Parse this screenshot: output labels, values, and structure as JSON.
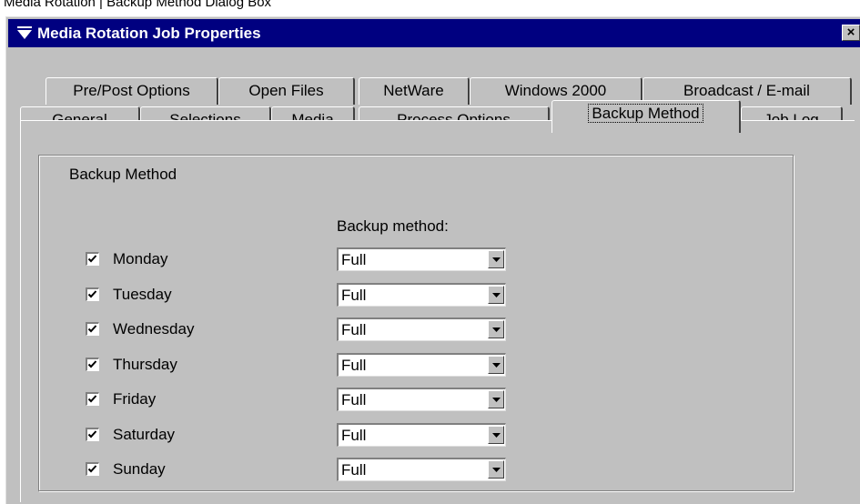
{
  "caption": "Media Rotation | Backup Method Dialog Box",
  "window": {
    "title": "Media Rotation Job Properties",
    "close_glyph": "×"
  },
  "tabs_top": [
    {
      "label": "Pre/Post Options"
    },
    {
      "label": "Open Files"
    },
    {
      "label": "NetWare"
    },
    {
      "label": "Windows 2000"
    },
    {
      "label": "Broadcast / E-mail"
    }
  ],
  "tabs_bottom": [
    {
      "label": "General"
    },
    {
      "label": "Selections"
    },
    {
      "label": "Media"
    },
    {
      "label": "Process Options"
    },
    {
      "label": "Backup Method",
      "active": true
    },
    {
      "label": "Job Log"
    }
  ],
  "group": {
    "label": "Backup Method",
    "column_header": "Backup method:",
    "rows": [
      {
        "day": "Monday",
        "checked": true,
        "method": "Full"
      },
      {
        "day": "Tuesday",
        "checked": true,
        "method": "Full"
      },
      {
        "day": "Wednesday",
        "checked": true,
        "method": "Full"
      },
      {
        "day": "Thursday",
        "checked": true,
        "method": "Full"
      },
      {
        "day": "Friday",
        "checked": true,
        "method": "Full"
      },
      {
        "day": "Saturday",
        "checked": true,
        "method": "Full"
      },
      {
        "day": "Sunday",
        "checked": true,
        "method": "Full"
      }
    ]
  },
  "colors": {
    "titlebar": "#000080",
    "face": "#c0c0c0",
    "field": "#ffffff"
  }
}
